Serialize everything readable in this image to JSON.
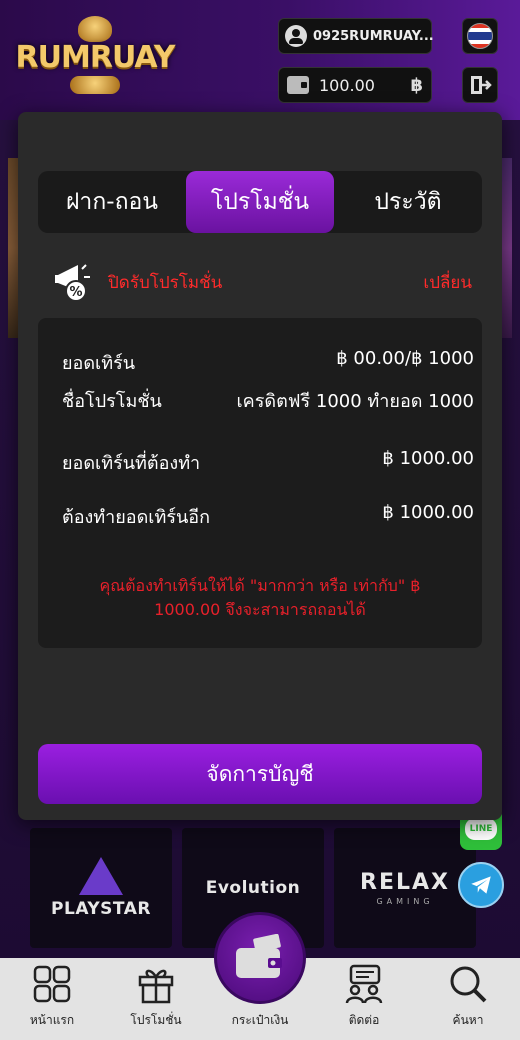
{
  "header": {
    "logo_text": "RUMRUAY",
    "username": "0925RUMRUAY...",
    "balance": "100.00",
    "currency_symbol": "฿",
    "language_flag": "thai-flag-icon"
  },
  "modal": {
    "tabs": [
      {
        "label": "ฝาก-ถอน",
        "active": false
      },
      {
        "label": "โปรโมชั่น",
        "active": true
      },
      {
        "label": "ประวัติ",
        "active": false
      }
    ],
    "promo_toggle_label": "ปิดรับโปรโมชั่น",
    "change_label": "เปลี่ยน",
    "rows": [
      {
        "label": "ยอดเทิร์น",
        "value": "฿ 00.00/฿ 1000"
      },
      {
        "label": "ชื่อโปรโมชั่น",
        "value": "เครดิตฟรี 1000 ทำยอด 1000"
      },
      {
        "label": "ยอดเทิร์นที่ต้องทำ",
        "value": "฿ 1000.00"
      },
      {
        "label": "ต้องทำยอดเทิร์นอีก",
        "value": "฿ 1000.00"
      }
    ],
    "warning": "คุณต้องทำเทิร์นให้ได้ \"มากกว่า หรือ เท่ากับ\" ฿ 1000.00 จึงจะสามารถถอนได้",
    "manage_button": "จัดการบัญชี"
  },
  "providers": [
    {
      "name": "PLAYSTAR",
      "sub": ""
    },
    {
      "name": "Evolution",
      "sub": ""
    },
    {
      "name": "RELAX",
      "sub": "GAMING"
    }
  ],
  "social": {
    "line_label": "LINE"
  },
  "bottom_nav": [
    {
      "label": "หน้าแรก",
      "icon": "grid-icon"
    },
    {
      "label": "โปรโมชั่น",
      "icon": "gift-icon"
    },
    {
      "label": "กระเป๋าเงิน",
      "icon": "wallet-icon"
    },
    {
      "label": "ติดต่อ",
      "icon": "contact-icon"
    },
    {
      "label": "ค้นหา",
      "icon": "search-icon"
    }
  ],
  "colors": {
    "accent_purple": "#8a1fd0",
    "alert_red": "#ff2b2b",
    "modal_bg": "#2a2a2a"
  }
}
